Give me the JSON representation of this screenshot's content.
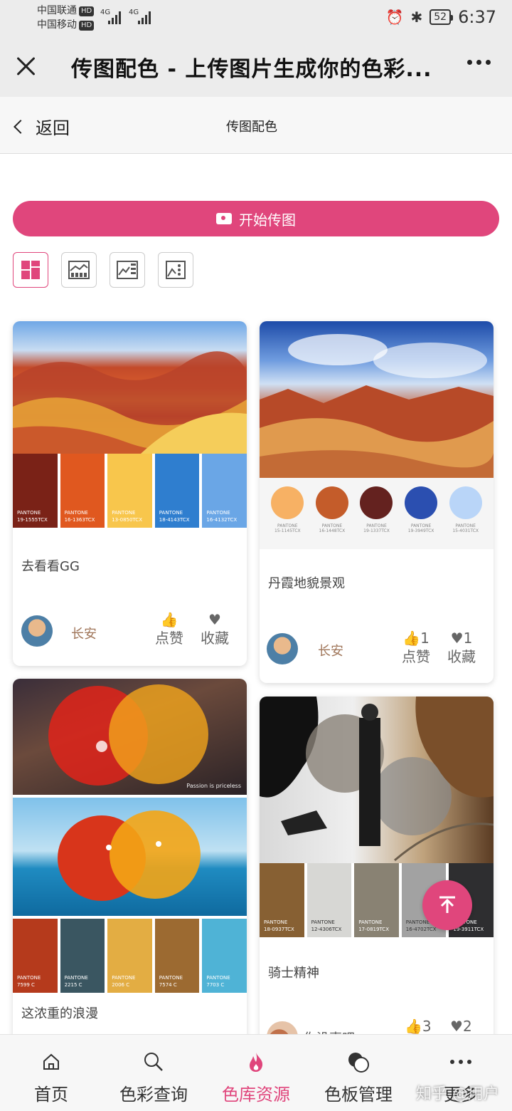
{
  "status": {
    "carrier1": "中国联通",
    "carrier2": "中国移动",
    "hd": "HD",
    "net": "4G",
    "battery": "52",
    "time": "6:37"
  },
  "window": {
    "title": "传图配色 - 上传图片生成你的色彩..."
  },
  "nav": {
    "back": "返回",
    "title": "传图配色"
  },
  "upload_label": "开始传图",
  "cards": [
    {
      "title": "去看看GG",
      "user": "长安",
      "like_label": "点赞",
      "fav_label": "收藏",
      "like_count": "",
      "fav_count": "",
      "swatches": [
        {
          "color": "#7a2217",
          "pantone": "PANTONE",
          "code": "19-1555TCX"
        },
        {
          "color": "#e0581f",
          "pantone": "PANTONE",
          "code": "16-1363TCX"
        },
        {
          "color": "#f8c64c",
          "pantone": "PANTONE",
          "code": "13-0850TCX"
        },
        {
          "color": "#2f7ecf",
          "pantone": "PANTONE",
          "code": "18-4143TCX"
        },
        {
          "color": "#6aa6e6",
          "pantone": "PANTONE",
          "code": "16-4132TCX"
        }
      ]
    },
    {
      "title": "丹霞地貌景观",
      "user": "长安",
      "like_label": "点赞",
      "fav_label": "收藏",
      "like_count": "1",
      "fav_count": "1",
      "swatches": [
        {
          "color": "#f7b164",
          "pantone": "PANTONE",
          "code": "15-1145TCX"
        },
        {
          "color": "#c45c2a",
          "pantone": "PANTONE",
          "code": "16-1448TCX"
        },
        {
          "color": "#64221f",
          "pantone": "PANTONE",
          "code": "19-1337TCX"
        },
        {
          "color": "#2b4fb0",
          "pantone": "PANTONE",
          "code": "19-3949TCX"
        },
        {
          "color": "#b9d5f8",
          "pantone": "PANTONE",
          "code": "15-4031TCX"
        }
      ]
    },
    {
      "title": "这浓重的浪漫",
      "caption": "Passion is priceless",
      "swatches": [
        {
          "color": "#b53a1c",
          "pantone": "PANTONE",
          "code": "7599 C"
        },
        {
          "color": "#3a5661",
          "pantone": "PANTONE",
          "code": "2215 C"
        },
        {
          "color": "#e3ad43",
          "pantone": "PANTONE",
          "code": "2006 C"
        },
        {
          "color": "#9c6a31",
          "pantone": "PANTONE",
          "code": "7574 C"
        },
        {
          "color": "#4fb3d6",
          "pantone": "PANTONE",
          "code": "7703 C"
        }
      ]
    },
    {
      "title": "骑士精神",
      "user": "你没事吧",
      "like_count": "3",
      "fav_count": "2",
      "swatches": [
        {
          "color": "#876033",
          "pantone": "PANTONE",
          "code": "18-0937TCX"
        },
        {
          "color": "#d7d7d4",
          "pantone": "PANTONE",
          "code": "12-4306TCX"
        },
        {
          "color": "#898273",
          "pantone": "PANTONE",
          "code": "17-0819TCX"
        },
        {
          "color": "#a2a2a2",
          "pantone": "PANTONE",
          "code": "16-4702TCX"
        },
        {
          "color": "#2e2e30",
          "pantone": "PANTONE",
          "code": "19-3911TCX"
        }
      ]
    }
  ],
  "tabs": [
    {
      "label": "首页",
      "icon": "home-icon"
    },
    {
      "label": "色彩查询",
      "icon": "search-icon"
    },
    {
      "label": "色库资源",
      "icon": "flame-icon",
      "active": true
    },
    {
      "label": "色板管理",
      "icon": "palette-icon"
    },
    {
      "label": "更多",
      "icon": "more-icon"
    }
  ],
  "watermark": "知乎 @用户",
  "colors": {
    "accent": "#e0467c"
  }
}
